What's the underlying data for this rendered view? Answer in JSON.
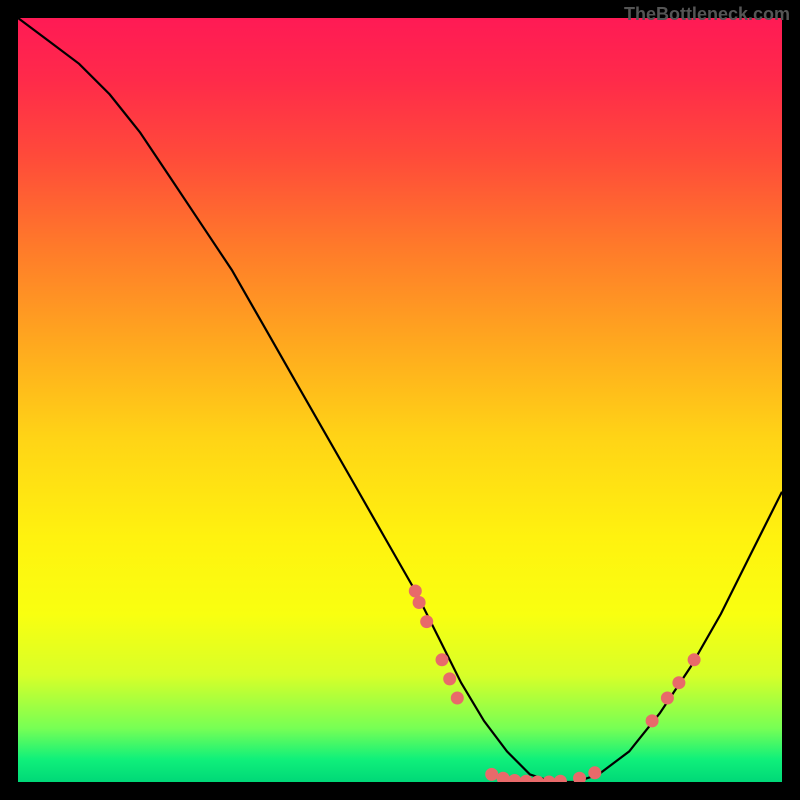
{
  "watermark": "TheBottleneck.com",
  "chart_data": {
    "type": "line",
    "title": "",
    "xlabel": "",
    "ylabel": "",
    "xlim": [
      0,
      100
    ],
    "ylim": [
      0,
      100
    ],
    "grid": false,
    "series": [
      {
        "name": "curve",
        "x": [
          0,
          4,
          8,
          12,
          16,
          20,
          24,
          28,
          32,
          36,
          40,
          44,
          48,
          52,
          55,
          58,
          61,
          64,
          67,
          70,
          73,
          76,
          80,
          84,
          88,
          92,
          96,
          100
        ],
        "y": [
          100,
          97,
          94,
          90,
          85,
          79,
          73,
          67,
          60,
          53,
          46,
          39,
          32,
          25,
          19,
          13,
          8,
          4,
          1,
          0,
          0,
          1,
          4,
          9,
          15,
          22,
          30,
          38
        ]
      }
    ],
    "markers": [
      {
        "x": 52.0,
        "y": 25.0
      },
      {
        "x": 52.5,
        "y": 23.5
      },
      {
        "x": 53.5,
        "y": 21.0
      },
      {
        "x": 55.5,
        "y": 16.0
      },
      {
        "x": 56.5,
        "y": 13.5
      },
      {
        "x": 57.5,
        "y": 11.0
      },
      {
        "x": 62.0,
        "y": 1.0
      },
      {
        "x": 63.5,
        "y": 0.5
      },
      {
        "x": 65.0,
        "y": 0.2
      },
      {
        "x": 66.5,
        "y": 0.1
      },
      {
        "x": 68.0,
        "y": 0.0
      },
      {
        "x": 69.5,
        "y": 0.0
      },
      {
        "x": 71.0,
        "y": 0.1
      },
      {
        "x": 73.5,
        "y": 0.5
      },
      {
        "x": 75.5,
        "y": 1.2
      },
      {
        "x": 83.0,
        "y": 8.0
      },
      {
        "x": 85.0,
        "y": 11.0
      },
      {
        "x": 86.5,
        "y": 13.0
      },
      {
        "x": 88.5,
        "y": 16.0
      }
    ],
    "background_gradient": {
      "top": "#ff1a55",
      "bottom": "#00d878"
    }
  }
}
